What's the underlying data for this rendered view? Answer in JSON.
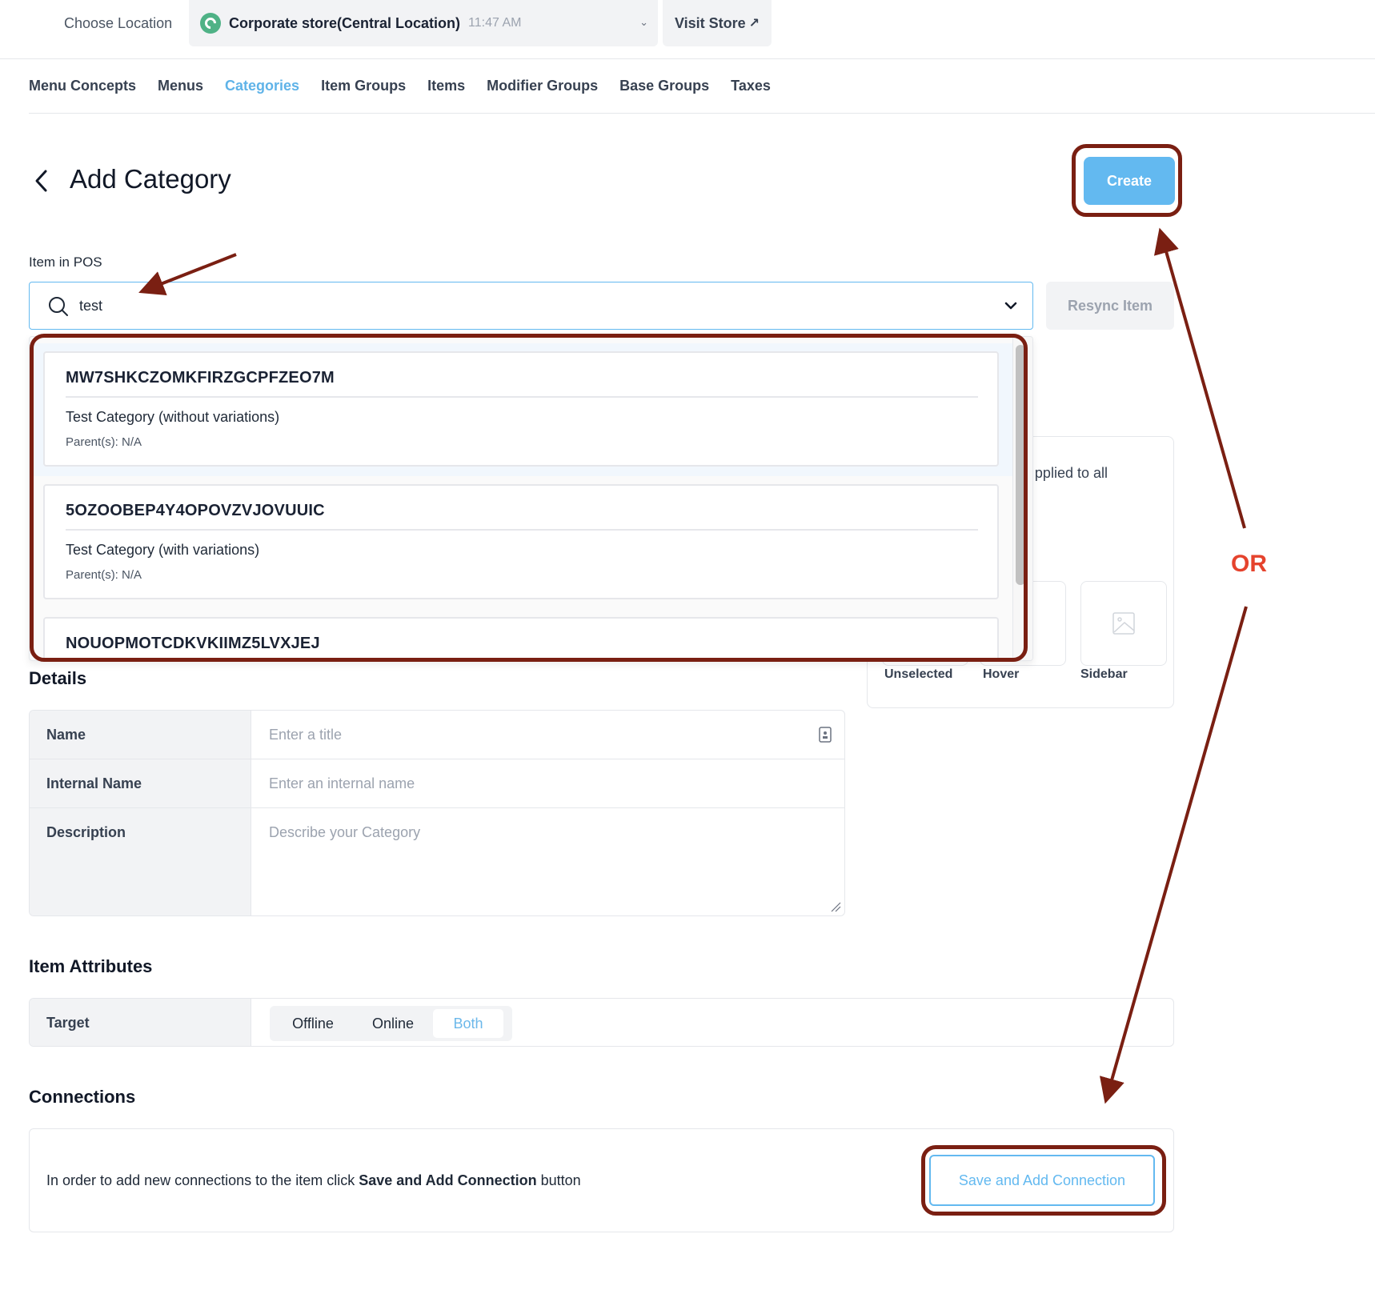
{
  "topbar": {
    "choose_location_label": "Choose Location",
    "location": {
      "icon": "store-logo-icon",
      "name": "Corporate store(Central Location)",
      "time": "11:47 AM"
    },
    "visit_store_label": "Visit Store",
    "visit_store_icon": "↗"
  },
  "tabs": [
    {
      "label": "Menu Concepts",
      "active": false
    },
    {
      "label": "Menus",
      "active": false
    },
    {
      "label": "Categories",
      "active": true
    },
    {
      "label": "Item Groups",
      "active": false
    },
    {
      "label": "Items",
      "active": false
    },
    {
      "label": "Modifier Groups",
      "active": false
    },
    {
      "label": "Base Groups",
      "active": false
    },
    {
      "label": "Taxes",
      "active": false
    }
  ],
  "header": {
    "title": "Add Category",
    "create_label": "Create"
  },
  "pos": {
    "label": "Item in POS",
    "search_value": "test",
    "resync_label": "Resync Item",
    "results": [
      {
        "code": "MW7SHKCZOMKFIRZGCPFZEO7M",
        "name": "Test Category (without variations)",
        "parents": "Parent(s): N/A",
        "highlighted": true
      },
      {
        "code": "5OZOOBEP4Y4OPOVZVJOVUUIC",
        "name": "Test Category (with variations)",
        "parents": "Parent(s): N/A",
        "highlighted": false
      },
      {
        "code": "NOUOPMOTCDKVKIIMZ5LVXJEJ",
        "name": "",
        "parents": "",
        "highlighted": false
      }
    ]
  },
  "images_panel": {
    "partial_text": "pplied to all",
    "tiles": [
      "Unselected",
      "Hover",
      "Sidebar"
    ]
  },
  "details": {
    "heading": "Details",
    "fields": [
      {
        "label": "Name",
        "placeholder": "Enter a title"
      },
      {
        "label": "Internal Name",
        "placeholder": "Enter an internal name"
      },
      {
        "label": "Description",
        "placeholder": "Describe your Category"
      }
    ]
  },
  "attributes": {
    "heading": "Item Attributes",
    "target_label": "Target",
    "options": [
      "Offline",
      "Online",
      "Both"
    ],
    "selected": "Both"
  },
  "connections": {
    "heading": "Connections",
    "text_before": "In order to add new connections to the item click ",
    "text_bold": "Save and Add Connection",
    "text_after": " button",
    "button_label": "Save and Add Connection"
  },
  "annotation": {
    "or_label": "OR",
    "color": "#7a1f12",
    "or_color": "#e5432d"
  },
  "colors": {
    "accent": "#63b9f0",
    "location_icon": "#4fb286"
  }
}
